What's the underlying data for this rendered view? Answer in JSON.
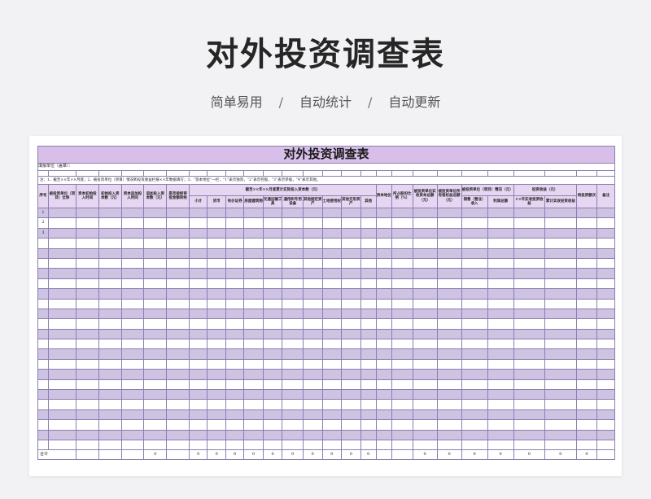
{
  "page": {
    "title": "对外投资调查表",
    "subtitle": [
      "简单易用",
      "自动统计",
      "自动更新"
    ],
    "separator": "/"
  },
  "sheet": {
    "title": "对外投资调查表",
    "unit_label": "填报单位（盖章）：",
    "note": "注：1、截至××年××月底；2、被投资单位（项目）情况和投资收益栏按××年数据填写；3、“资本地位”一栏，“1”表示独资，“2”表示控股，“3”表示参股，“4”表示其他。",
    "headers_top": {
      "seq": "序号",
      "invested_unit": "被投资单位（项目）全称",
      "initial_time": "资本初始投入时间",
      "initial_amount": "初始投入资本数（元）",
      "added_time": "资本追加投入时间",
      "added_amount": "追加投入资本数（元）",
      "approved": "是否按经审批金额转经",
      "cumulative_group": "截至××年××月底累计实际投入资本数（元）",
      "capital_status": "资本地位",
      "share_ratio": "所占股份比例（%）",
      "paid_capital": "被投资单位实收资本总额（元）",
      "equity_total": "被投资单位所有者权益总额（元）",
      "unit_status_group": "被投资单位（项目）情况（元）",
      "income_group": "投资收益（元）",
      "reinvest": "再投资额次",
      "remark": "备注"
    },
    "headers_sub": {
      "subtotal": "小计",
      "currency": "货币",
      "securities": "有价证券",
      "buildings": "房屋建筑物",
      "transport": "交通运输工具",
      "equipment": "通用和专用设备",
      "other_fixed": "其他固定资产",
      "land_use": "土地使用权",
      "other_intangible": "其他无形资产",
      "other": "其他",
      "sales_income": "销售（营业）收入",
      "total_profit": "利润总额",
      "year_income": "××年实收投资收益",
      "cumulative_income": "累计实收投资收益"
    },
    "row_indices": [
      "1",
      "2",
      "3"
    ],
    "data_row_count": 24,
    "total_label": "合计",
    "total_values": [
      "0",
      "0",
      "0",
      "0",
      "0",
      "0",
      "0",
      "0",
      "0",
      "0",
      "0",
      "0",
      "0",
      "0",
      "0",
      "0",
      "0",
      "0"
    ]
  }
}
